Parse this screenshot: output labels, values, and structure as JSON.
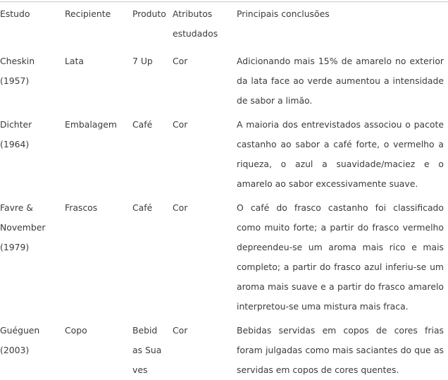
{
  "document": {
    "type": "table",
    "text_color": "#3b3b3b",
    "rule_color": "#c9c9c9",
    "background": "#ffffff"
  },
  "table": {
    "headers": {
      "estudo": "Estudo",
      "recipiente": "Recipiente",
      "produto": "Atributos",
      "produto_label": "Produto",
      "atributos_line1": "Atributos",
      "atributos_line2": "estudados",
      "conclusoes": "Principais conclusões"
    },
    "rows": [
      {
        "estudo_line1": "Cheskin",
        "estudo_line2": "(1957)",
        "recipiente": "Lata",
        "produto": "7 Up",
        "atributos": "Cor",
        "conclusoes": "Adicionando mais 15% de amarelo no exterior da lata face ao verde aumentou a intensidade de sabor a limão."
      },
      {
        "estudo_line1": "Dichter",
        "estudo_line2": "(1964)",
        "recipiente": "Embalagem",
        "produto": "Café",
        "atributos": "Cor",
        "conclusoes": "A maioria dos entrevistados associou o pacote castanho ao sabor a café forte, o vermelho a riqueza, o azul a suavidade/maciez e o amarelo ao sabor excessivamente suave."
      },
      {
        "estudo_line1": "Favre &",
        "estudo_line2": "November",
        "estudo_line3": "(1979)",
        "recipiente": "Frascos",
        "produto": "Café",
        "atributos": "Cor",
        "conclusoes": "O café do frasco castanho foi classificado como muito forte; a partir do frasco vermelho depreendeu-se um aroma mais rico e mais completo; a partir do frasco azul inferiu-se um aroma mais suave e a partir do frasco amarelo interpretou-se uma mistura mais fraca."
      },
      {
        "estudo_line1": "Guéguen",
        "estudo_line2": "(2003)",
        "recipiente": "Copo",
        "produto": "Bebidas Suaves",
        "atributos": "Cor",
        "conclusoes": "Bebidas servidas em copos de cores frias foram julgadas como mais saciantes do que as servidas em copos de cores quentes."
      }
    ]
  }
}
